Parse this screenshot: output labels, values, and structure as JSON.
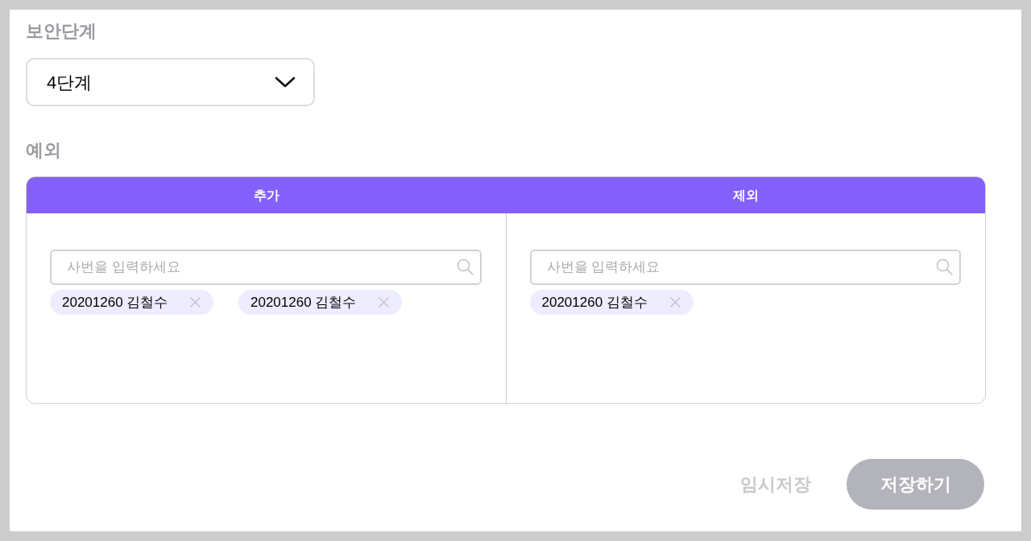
{
  "security_level": {
    "label": "보안단계",
    "select": {
      "value": "4단계"
    }
  },
  "exceptions": {
    "label": "예외",
    "columns": [
      {
        "header": "추가",
        "search": {
          "placeholder": "사번을 입력하세요"
        },
        "tags": [
          {
            "text": "20201260 김철수"
          },
          {
            "text": "20201260 김철수"
          }
        ]
      },
      {
        "header": "제외",
        "search": {
          "placeholder": "사번을 입력하세요"
        },
        "tags": [
          {
            "text": "20201260 김철수"
          }
        ]
      }
    ]
  },
  "actions": [
    {
      "kind": "text",
      "label": "임시저장",
      "disabled": true
    },
    {
      "kind": "filled",
      "label": "저장하기",
      "disabled": true
    }
  ]
}
